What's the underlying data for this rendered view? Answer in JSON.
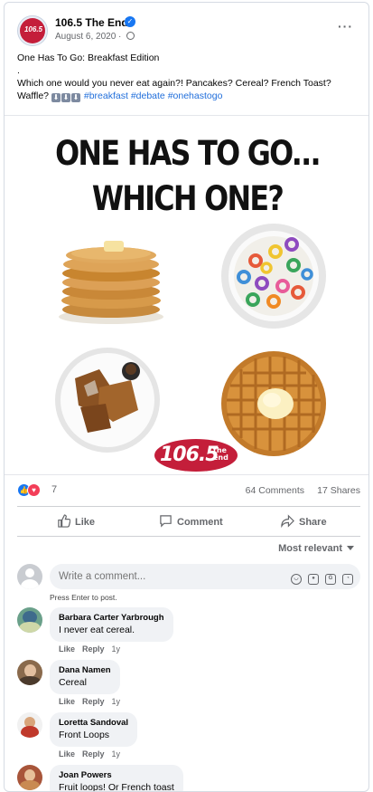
{
  "post": {
    "page_name": "106.5 The End",
    "date": "August 6, 2020 · ",
    "verified_glyph": "✓",
    "more_glyph": "···",
    "text_line1": "One Has To Go: Breakfast Edition",
    "text_line2": ".",
    "text_line3": "Which one would you never eat again?! Pancakes? Cereal? French Toast?",
    "text_line4_prefix": "Waffle?",
    "hashtags": "#breakfast #debate #onehastogo",
    "avatar_logo": "106.5"
  },
  "image": {
    "headline_line1": "ONE HAS TO GO...",
    "headline_line2": "WHICH ONE?",
    "logo_text": "106.5",
    "logo_sub": "the end"
  },
  "stats": {
    "reaction_count": "7",
    "comments": "64 Comments",
    "shares": "17 Shares"
  },
  "actions": {
    "like": "Like",
    "comment": "Comment",
    "share": "Share"
  },
  "sort_label": "Most relevant",
  "composer": {
    "placeholder": "Write a comment...",
    "press_enter": "Press Enter to post.",
    "icons": [
      "emoji-icon",
      "camera-icon",
      "gif-icon",
      "sticker-icon"
    ]
  },
  "comments": [
    {
      "author": "Barbara Carter Yarbrough",
      "text": "I never eat cereal.",
      "like": "Like",
      "reply": "Reply",
      "time": "1y"
    },
    {
      "author": "Dana Namen",
      "text": "Cereal",
      "like": "Like",
      "reply": "Reply",
      "time": "1y"
    },
    {
      "author": "Loretta Sandoval",
      "text": "Front Loops",
      "like": "Like",
      "reply": "Reply",
      "time": "1y"
    },
    {
      "author": "Joan Powers",
      "text": "Fruit loops! Or French toast",
      "like": "Like",
      "reply": "Reply",
      "time": "1y"
    }
  ],
  "colors": {
    "brand_blue": "#1877f2",
    "love_red": "#f33e58",
    "hashtag": "#216fdb",
    "logo_red": "#c41e3a"
  }
}
